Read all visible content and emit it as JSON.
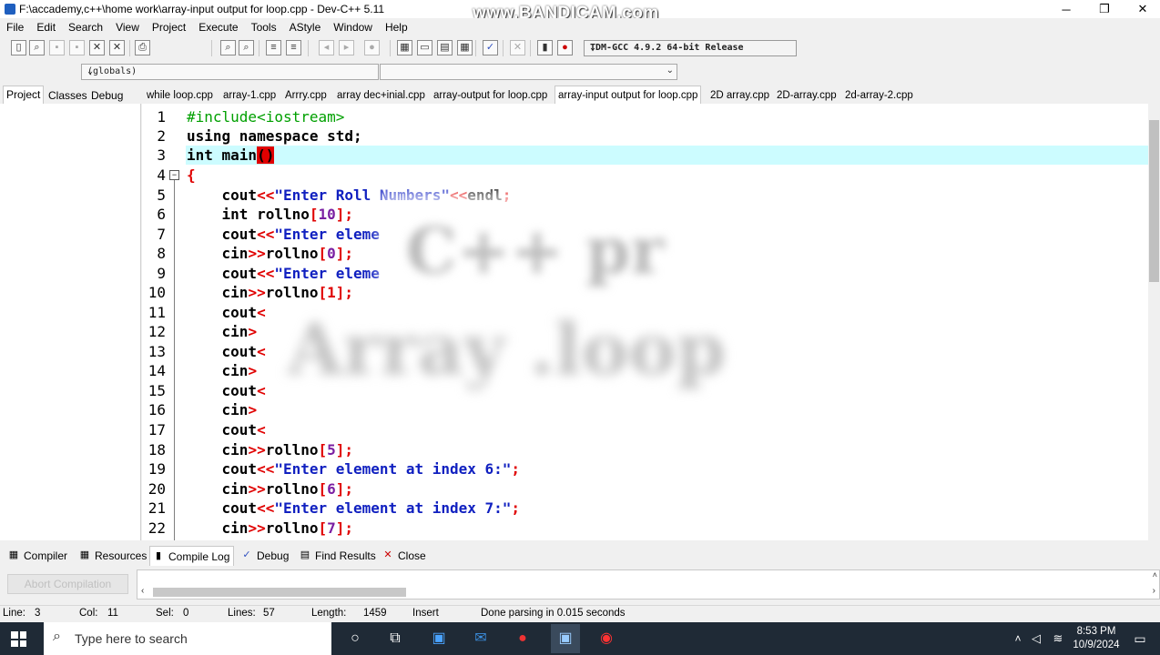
{
  "window": {
    "title": "F:\\accademy,c++\\home work\\array-input output for loop.cpp - Dev-C++ 5.11",
    "watermark": "www.BANDICAM.com",
    "minimize": "─",
    "maximize": "❐",
    "close": "✕"
  },
  "menu": [
    "File",
    "Edit",
    "Search",
    "View",
    "Project",
    "Execute",
    "Tools",
    "AStyle",
    "Window",
    "Help"
  ],
  "toolbar": {
    "compiler": "TDM-GCC 4.9.2 64-bit Release"
  },
  "globals": "(globals)",
  "left_tabs": [
    "Project",
    "Classes",
    "Debug"
  ],
  "file_tabs": [
    "while loop.cpp",
    "array-1.cpp",
    "Arrry.cpp",
    "array dec+inial.cpp",
    "array-output for loop.cpp",
    "array-input output for loop.cpp",
    "2D array.cpp",
    "2D-array.cpp",
    "2d-array-2.cpp"
  ],
  "active_file_tab": "array-input output for loop.cpp",
  "line_numbers": [
    "1",
    "2",
    "3",
    "4",
    "5",
    "6",
    "7",
    "8",
    "9",
    "10",
    "11",
    "12",
    "13",
    "14",
    "15",
    "16",
    "17",
    "18",
    "19",
    "20",
    "21",
    "22"
  ],
  "code": {
    "l1": "#include<iostream>",
    "l2": "using namespace std;",
    "l3a": "int main",
    "l3b": "()",
    "l4": "{",
    "l5a": "    cout",
    "l5b": "<<",
    "l5c": "\"Enter Roll Numbers\"",
    "l5d": "<<",
    "l5e": "endl",
    "l5f": ";",
    "l6a": "    int rollno",
    "l6b": "[",
    "l6c": "10",
    "l6d": "];",
    "l7a": "    cout",
    "l7b": "<<",
    "l7c": "\"Enter eleme",
    "l8a": "    cin",
    "l8b": ">>",
    "l8c": "rollno",
    "l8d": "[",
    "l8e": "0",
    "l8f": "];",
    "l9a": "    cout",
    "l9b": "<<",
    "l9c": "\"Enter eleme",
    "l10a": "    cin",
    "l10b": ">>",
    "l10c": "rollno",
    "l10d": "[1];",
    "l11a": "    cout",
    "l11b": "<",
    "l12a": "    cin",
    "l12b": ">",
    "l13a": "    cout",
    "l13b": "<",
    "l14a": "    cin",
    "l14b": ">",
    "l15a": "    cout",
    "l15b": "<",
    "l16a": "    cin",
    "l16b": ">",
    "l17a": "    cout",
    "l17b": "<",
    "l18a": "    cin",
    "l18b": ">>",
    "l18c": "rollno",
    "l18d": "[",
    "l18e": "5",
    "l18f": "];",
    "l19a": "    cout",
    "l19b": "<<",
    "l19c": "\"Enter element at index 6:\"",
    "l19d": ";",
    "l20a": "    cin",
    "l20b": ">>",
    "l20c": "rollno",
    "l20d": "[",
    "l20e": "6",
    "l20f": "];",
    "l21a": "    cout",
    "l21b": "<<",
    "l21c": "\"Enter element at index 7:\"",
    "l21d": ";",
    "l22a": "    cin",
    "l22b": ">>",
    "l22c": "rollno",
    "l22d": "[",
    "l22e": "7",
    "l22f": "];"
  },
  "overlay_text": {
    "word1": "C++ pr",
    "word2": "Array .loop"
  },
  "bottom_tabs": [
    "Compiler",
    "Resources",
    "Compile Log",
    "Debug",
    "Find Results",
    "Close"
  ],
  "active_bottom_tab": "Compile Log",
  "abort_button": "Abort Compilation",
  "status": {
    "line_label": "Line:",
    "line": "3",
    "col_label": "Col:",
    "col": "11",
    "sel_label": "Sel:",
    "sel": "0",
    "lines_label": "Lines:",
    "lines": "57",
    "length_label": "Length:",
    "length": "1459",
    "mode": "Insert",
    "message": "Done parsing in 0.015 seconds"
  },
  "taskbar": {
    "search_placeholder": "Type here to search",
    "time": "8:53 PM",
    "date": "10/9/2024"
  }
}
